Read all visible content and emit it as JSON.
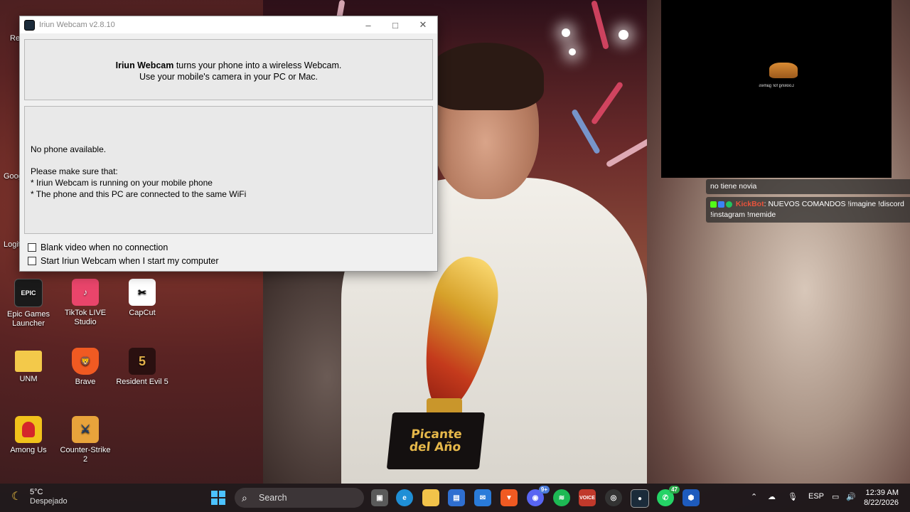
{
  "iriun": {
    "title": "Iriun Webcam v2.8.10",
    "intro_brand": "Iriun Webcam",
    "intro_rest": " turns your phone into a wireless Webcam.",
    "intro_line2": "Use your mobile's camera in your PC or Mac.",
    "status": "No phone available.",
    "hint_heading": "Please make sure that:",
    "hint_1": "* Iriun Webcam is running on your mobile phone",
    "hint_2": "* The phone and this PC are connected to the same WiFi",
    "option_blank": "Blank video when no connection",
    "option_startup": "Start Iriun Webcam when I start my computer",
    "option_blank_checked": false,
    "option_startup_checked": false
  },
  "desktop": {
    "partial_labels": [
      "Re",
      "Goog",
      "Logit"
    ],
    "icons": [
      {
        "label": "Epic Games Launcher",
        "icon": "epic-games-icon"
      },
      {
        "label": "TikTok LIVE Studio",
        "icon": "tiktok-live-icon"
      },
      {
        "label": "CapCut",
        "icon": "capcut-icon"
      },
      {
        "label": "UNM",
        "icon": "folder-icon"
      },
      {
        "label": "Brave",
        "icon": "brave-icon"
      },
      {
        "label": "Resident Evil 5",
        "icon": "resident-evil-icon"
      },
      {
        "label": "Among Us",
        "icon": "among-us-icon"
      },
      {
        "label": "Counter-Strike 2",
        "icon": "counter-strike-icon"
      }
    ]
  },
  "stream": {
    "trophy_line1": "Picante",
    "trophy_line2": "del Año",
    "preview_text": "Looking for games"
  },
  "chat": {
    "msg1_text": "no tiene novia",
    "msg2_nick": "KickBot",
    "msg2_text": ": NUEVOS COMANDOS !imagine !discord !instagram !memide"
  },
  "taskbar": {
    "temp": "5°C",
    "weather": "Despejado",
    "search_label": "Search",
    "discord_badge": "9+",
    "whatsapp_badge": "47",
    "voice_label": "VOICE",
    "language": "ESP",
    "time": "12:39 AM",
    "date": "8/22/2026"
  },
  "colors": {
    "accent": "#4cc2ff",
    "kick_green": "#53fc18",
    "kickbot_nick": "#e8533c"
  }
}
